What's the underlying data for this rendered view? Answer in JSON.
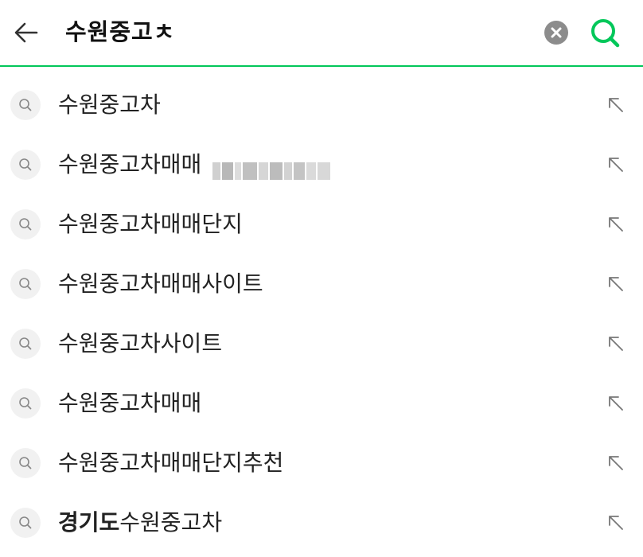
{
  "search": {
    "query": "수원중고ㅊ",
    "accent_color": "#03c75a",
    "icons": {
      "back": "arrow-left-icon",
      "clear": "clear-circle-icon",
      "search": "search-icon"
    }
  },
  "suggestions": [
    {
      "bold": "",
      "text": "수원중고차",
      "blurred": false
    },
    {
      "bold": "",
      "text": "수원중고차매매",
      "blurred": true
    },
    {
      "bold": "",
      "text": "수원중고차매매단지",
      "blurred": false
    },
    {
      "bold": "",
      "text": "수원중고차매매사이트",
      "blurred": false
    },
    {
      "bold": "",
      "text": "수원중고차사이트",
      "blurred": false
    },
    {
      "bold": "",
      "text": "수원중고차매매",
      "blurred": false
    },
    {
      "bold": "",
      "text": "수원중고차매매단지추천",
      "blurred": false
    },
    {
      "bold": "경기도",
      "text": "수원중고차",
      "blurred": false
    }
  ],
  "item_icons": {
    "left": "search-icon",
    "right": "arrow-up-left-icon"
  }
}
